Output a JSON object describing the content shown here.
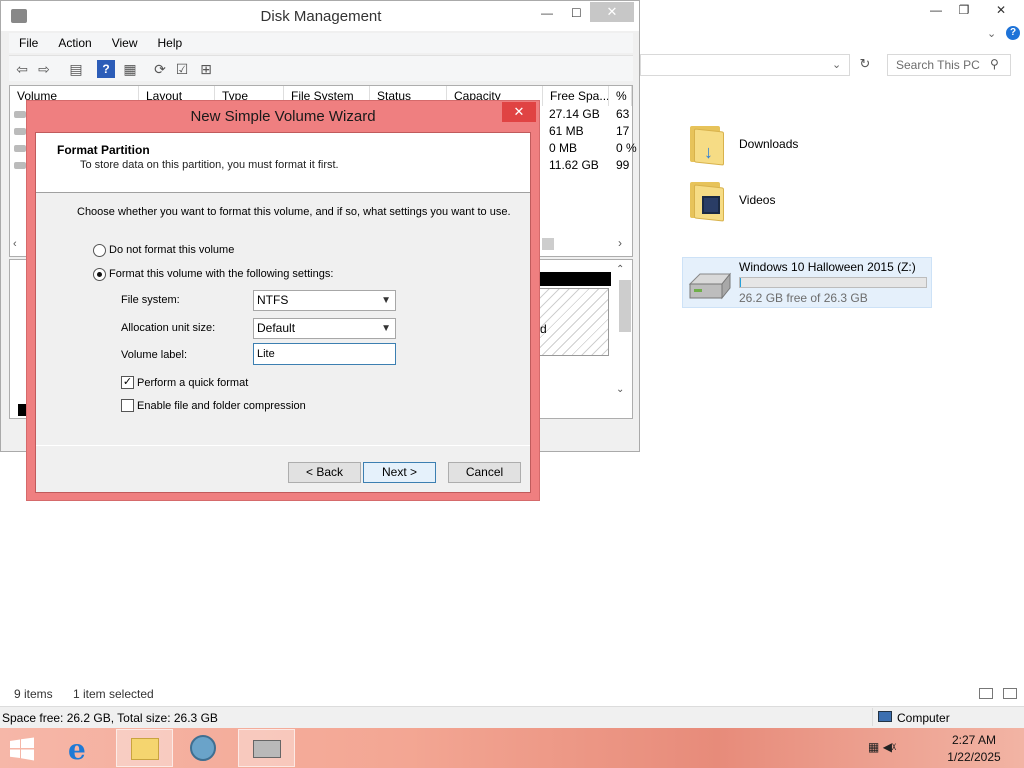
{
  "explorer": {
    "search_placeholder": "Search This PC",
    "folders": [
      {
        "label": "Downloads"
      },
      {
        "label": "Videos"
      }
    ],
    "drive": {
      "name": "Windows 10 Halloween 2015 (Z:)",
      "free_text": "26.2 GB free of 26.3 GB",
      "used_fraction": 0.004
    },
    "status": {
      "items": "9 items",
      "selected": "1 item selected"
    },
    "bottom": {
      "space": "Space free: 26.2 GB, Total size: 26.3 GB",
      "computer": "Computer"
    }
  },
  "disk_mgmt": {
    "title": "Disk Management",
    "menu": [
      "File",
      "Action",
      "View",
      "Help"
    ],
    "columns": [
      "Volume",
      "Layout",
      "Type",
      "File System",
      "Status",
      "Capacity",
      "Free Spa...",
      "% F"
    ],
    "rows": [
      {
        "free": "27.14 GB",
        "pct": "63"
      },
      {
        "free": "61 MB",
        "pct": "17"
      },
      {
        "free": "0 MB",
        "pct": "0 %"
      },
      {
        "free": "11.62 GB",
        "pct": "99"
      }
    ],
    "lower_text_d": "d"
  },
  "wizard": {
    "title": "New Simple Volume Wizard",
    "header_title": "Format Partition",
    "header_subtitle": "To store data on this partition, you must format it first.",
    "instruction": "Choose whether you want to format this volume, and if so, what settings you want to use.",
    "radio_no_format": "Do not format this volume",
    "radio_format": "Format this volume with the following settings:",
    "fs_label": "File system:",
    "fs_value": "NTFS",
    "alloc_label": "Allocation unit size:",
    "alloc_value": "Default",
    "vol_label": "Volume label:",
    "vol_value": "Lite",
    "quick_format": "Perform a quick format",
    "compression": "Enable file and folder compression",
    "back": "< Back",
    "next": "Next >",
    "cancel": "Cancel"
  },
  "taskbar": {
    "time": "2:27 AM",
    "date": "1/22/2025",
    "accent": "#f3a693"
  }
}
